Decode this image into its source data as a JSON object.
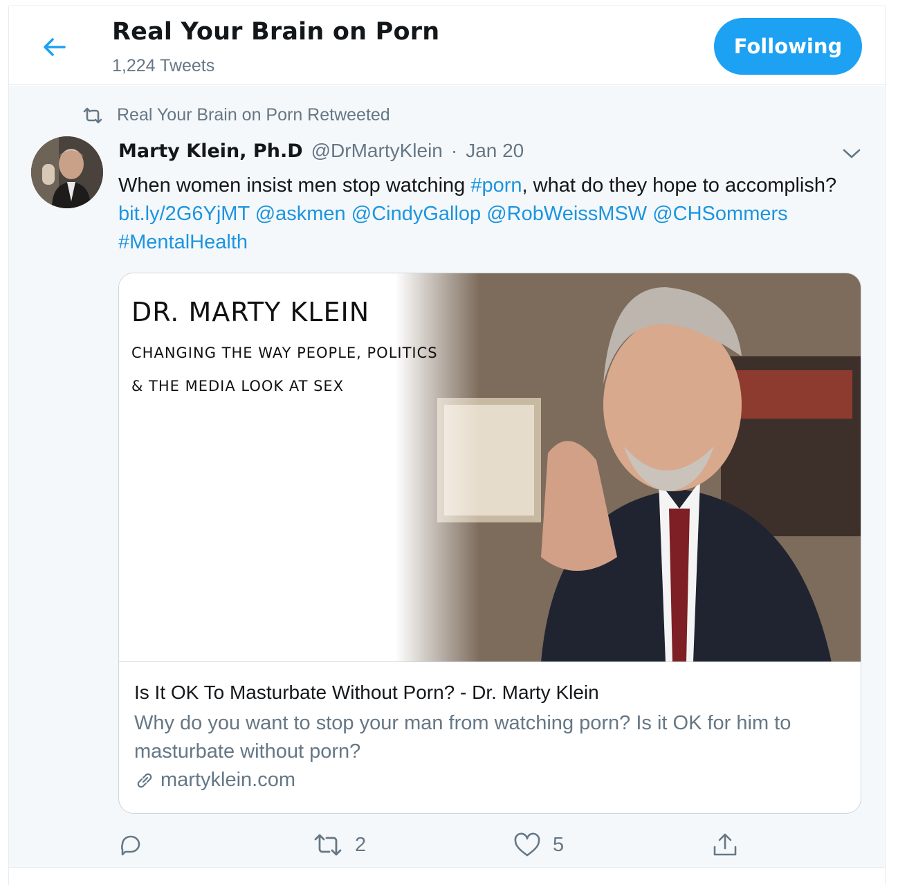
{
  "header": {
    "title": "Real Your Brain on Porn",
    "tweet_count": "1,224 Tweets",
    "follow_label": "Following"
  },
  "tweet": {
    "retweeted_by": "Real Your Brain on Porn Retweeted",
    "author_name": "Marty Klein, Ph.D",
    "author_handle": "@DrMartyKlein",
    "separator": "·",
    "date": "Jan 20",
    "text": {
      "t1": "When women insist men stop watching ",
      "hashtag1": "#porn",
      "t2": ", what do they hope to accomplish? ",
      "link1": "bit.ly/2G6YjMT",
      "mention1": "@askmen",
      "mention2": "@CindyGallop",
      "mention3": "@RobWeissMSW",
      "mention4": "@CHSommers",
      "hashtag2": "#MentalHealth"
    },
    "card": {
      "image_title": "DR. MARTY KLEIN",
      "image_line1": "CHANGING THE WAY PEOPLE, POLITICS",
      "image_line2": "& THE MEDIA LOOK AT SEX",
      "title": "Is It OK To Masturbate Without Porn? - Dr. Marty Klein",
      "description": "Why do you want to stop your man from watching porn? Is it OK for him to masturbate without porn?",
      "domain": "martyklein.com"
    },
    "actions": {
      "reply_count": "",
      "retweet_count": "2",
      "like_count": "5"
    }
  },
  "colors": {
    "accent": "#1da1f2",
    "link": "#1b95e0",
    "secondary_text": "#657786",
    "tweet_bg": "#f5f8fa"
  },
  "icons": [
    "back-arrow-icon",
    "retweet-icon",
    "chevron-down-icon",
    "link-icon",
    "reply-icon",
    "like-icon",
    "share-icon"
  ]
}
